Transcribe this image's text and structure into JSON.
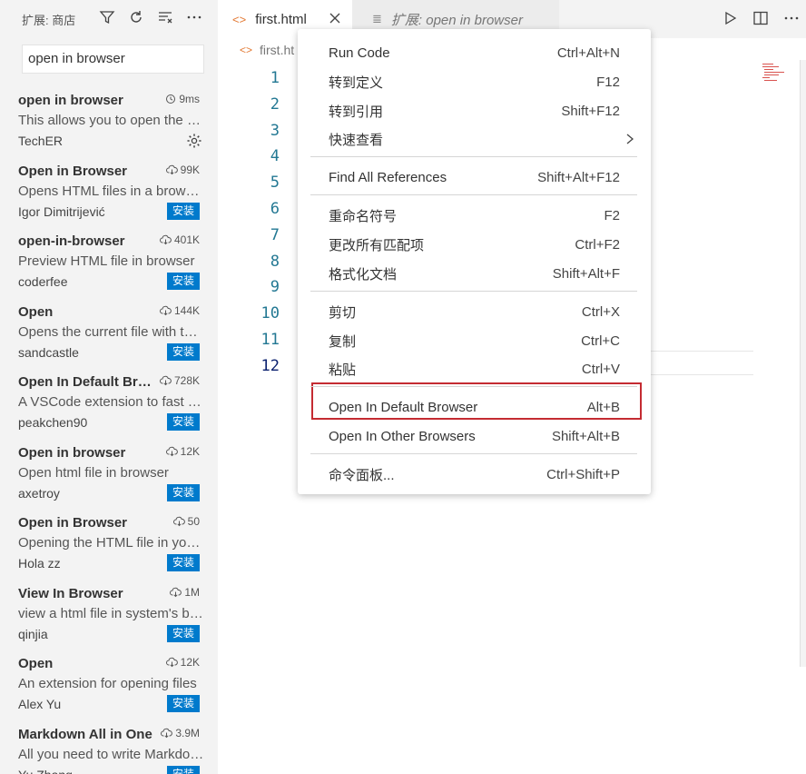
{
  "sidebar": {
    "title": "扩展: 商店",
    "search_value": "open in browser",
    "extensions": [
      {
        "name": "open in browser",
        "stat": "9ms",
        "stat_icon": "history-icon",
        "desc": "This allows you to open the current file in your default browser",
        "author": "TechER",
        "action": "gear"
      },
      {
        "name": "Open in Browser",
        "stat": "99K",
        "stat_icon": "download-icon",
        "desc": "Opens HTML files in a browser",
        "author": "Igor Dimitrijević",
        "action": "安装"
      },
      {
        "name": "open-in-browser",
        "stat": "401K",
        "stat_icon": "download-icon",
        "desc": "Preview HTML file in browser",
        "author": "coderfee",
        "action": "安装"
      },
      {
        "name": "Open",
        "stat": "144K",
        "stat_icon": "download-icon",
        "desc": "Opens the current file with the default app",
        "author": "sandcastle",
        "action": "安装"
      },
      {
        "name": "Open In Default Browser",
        "stat": "728K",
        "stat_icon": "download-icon",
        "desc": "A VSCode extension to fast open html",
        "author": "peakchen90",
        "action": "安装"
      },
      {
        "name": "Open in browser",
        "stat": "12K",
        "stat_icon": "download-icon",
        "desc": "Open html file in browser",
        "author": "axetroy",
        "action": "安装"
      },
      {
        "name": "Open in Browser",
        "stat": "50",
        "stat_icon": "download-icon",
        "desc": "Opening the HTML file in your browser",
        "author": "Hola zz",
        "action": "安装"
      },
      {
        "name": "View In Browser",
        "stat": "1M",
        "stat_icon": "download-icon",
        "desc": "view a html file in system's browser",
        "author": "qinjia",
        "action": "安装"
      },
      {
        "name": "Open",
        "stat": "12K",
        "stat_icon": "download-icon",
        "desc": "An extension for opening files",
        "author": "Alex Yu",
        "action": "安装"
      },
      {
        "name": "Markdown All in One",
        "stat": "3.9M",
        "stat_icon": "download-icon",
        "desc": "All you need to write Markdown",
        "author": "Yu Zhang",
        "action": "安装"
      }
    ]
  },
  "tabs": [
    {
      "label": "first.html",
      "active": true
    },
    {
      "label": "扩展: open in browser",
      "active": false
    }
  ],
  "breadcrumb": "first.ht",
  "line_numbers": [
    "1",
    "2",
    "3",
    "4",
    "5",
    "6",
    "7",
    "8",
    "9",
    "10",
    "11",
    "12"
  ],
  "context_menu": {
    "items": [
      {
        "label": "Run Code",
        "shortcut": "Ctrl+Alt+N"
      },
      {
        "label": "转到定义",
        "shortcut": "F12"
      },
      {
        "label": "转到引用",
        "shortcut": "Shift+F12"
      },
      {
        "label": "快速查看",
        "shortcut": ""
      },
      {
        "label": "Find All References",
        "shortcut": "Shift+Alt+F12"
      },
      {
        "label": "重命名符号",
        "shortcut": "F2"
      },
      {
        "label": "更改所有匹配项",
        "shortcut": "Ctrl+F2"
      },
      {
        "label": "格式化文档",
        "shortcut": "Shift+Alt+F"
      },
      {
        "label": "剪切",
        "shortcut": "Ctrl+X"
      },
      {
        "label": "复制",
        "shortcut": "Ctrl+C"
      },
      {
        "label": "粘贴",
        "shortcut": "Ctrl+V"
      },
      {
        "label": "Open In Default Browser",
        "shortcut": "Alt+B"
      },
      {
        "label": "Open In Other Browsers",
        "shortcut": "Shift+Alt+B"
      },
      {
        "label": "命令面板...",
        "shortcut": "Ctrl+Shift+P"
      }
    ]
  },
  "colors": {
    "accent": "#007acc",
    "highlight_border": "#c42b32",
    "line_number": "#237893"
  }
}
